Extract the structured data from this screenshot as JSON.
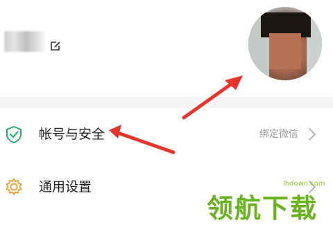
{
  "menu": {
    "security": {
      "label": "帐号与安全",
      "value": "绑定微信"
    },
    "general": {
      "label": "通用设置"
    }
  },
  "watermark": {
    "url": "lhdown.com",
    "text": "领航下载"
  },
  "icons": {
    "security": "shield-check-icon",
    "general": "gear-icon",
    "edit": "edit-icon",
    "chevron": "chevron-right-icon"
  },
  "colors": {
    "accent": "#20b26b",
    "gear": "#f1a33a",
    "annotation": "#e8352c",
    "watermark": "#69b31f"
  }
}
